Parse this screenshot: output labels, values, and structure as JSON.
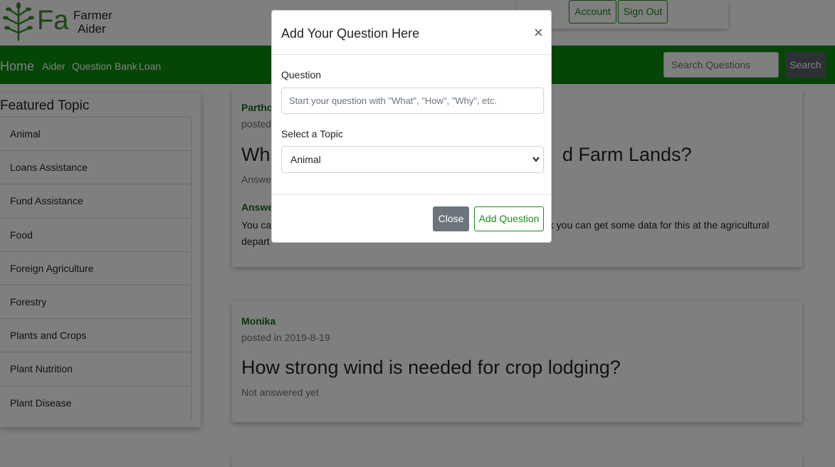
{
  "brand": {
    "abbr": "Fa",
    "line1": "Farmer",
    "line2": "Aider"
  },
  "account": {
    "account_label": "Account",
    "signout_label": "Sign Out"
  },
  "nav": {
    "home": "Home",
    "aider": "Aider",
    "question_bank": "Question Bank",
    "loan": "Loan"
  },
  "search": {
    "placeholder": "Search Questions",
    "button": "Search"
  },
  "sidebar": {
    "title": "Featured Topic",
    "items": [
      "Animal",
      "Loans Assistance",
      "Fund Assistance",
      "Food",
      "Foreign Agriculture",
      "Forestry",
      "Plants and Crops",
      "Plant Nutrition",
      "Plant Disease"
    ]
  },
  "posts": [
    {
      "author": "Partho",
      "posted": "posted",
      "title": "Wha",
      "title_tail": "d Farm Lands?",
      "status": "Answer",
      "answer_label": "Answer",
      "answer_text_left": "You ca",
      "answer_text_right": "nk you can get some data for this at the agricultural",
      "answer_text_line2": "depart"
    },
    {
      "author": "Monika",
      "posted": "posted in 2019-8-19",
      "title": "How strong wind is needed for crop lodging?",
      "status": "Not answered yet"
    }
  ],
  "modal": {
    "title": "Add Your Question Here",
    "close_symbol": "×",
    "question_label": "Question",
    "question_placeholder": "Start your question with \"What\", \"How\", \"Why\", etc.",
    "topic_label": "Select a Topic",
    "topic_selected": "Animal",
    "close_button": "Close",
    "add_button": "Add Question"
  },
  "colors": {
    "brand_green": "#0b8a0b",
    "accent_green": "#1e8a1e",
    "secondary": "#6c757d"
  }
}
